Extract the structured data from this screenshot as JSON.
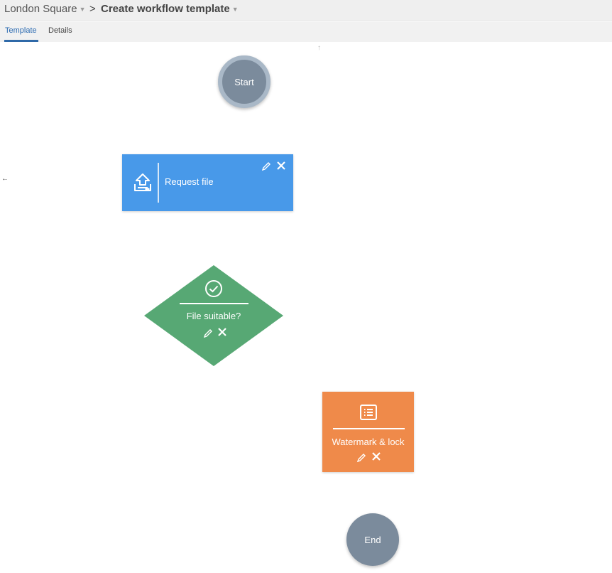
{
  "header": {
    "breadcrumb_root": "London Square",
    "breadcrumb_separator": ">",
    "page_title": "Create workflow template"
  },
  "tabs": [
    {
      "label": "Template",
      "active": true
    },
    {
      "label": "Details",
      "active": false
    }
  ],
  "canvas": {
    "start_node": {
      "label": "Start"
    },
    "end_node": {
      "label": "End"
    },
    "nodes": [
      {
        "type": "task",
        "label": "Request file",
        "icon": "upload-icon",
        "color": "#4899e9"
      },
      {
        "type": "decision",
        "label": "File suitable?",
        "icon": "check-circle-icon",
        "color": "#57a874"
      },
      {
        "type": "task",
        "label": "Watermark & lock",
        "icon": "list-icon",
        "color": "#ef8a4a"
      }
    ]
  },
  "colors": {
    "accent": "#2f69a8",
    "terminal_node": "#7b8b9c",
    "terminal_ring": "#a9b8c7"
  }
}
